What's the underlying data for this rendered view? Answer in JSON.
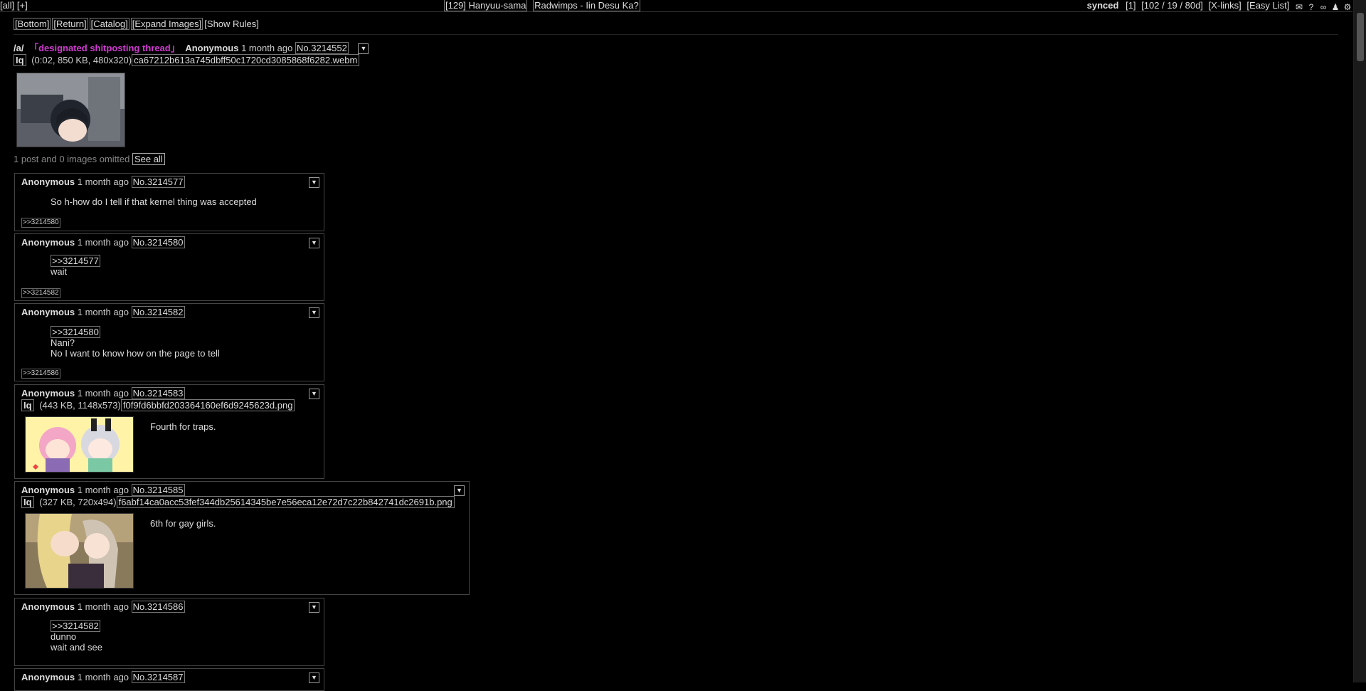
{
  "topbar": {
    "left": [
      "[all]",
      "[+]"
    ],
    "board_title": "[129] Hanyuu-sama",
    "song": "Radwimps - Iin Desu Ka?",
    "synced": "synced",
    "count1": "[1]",
    "stats": "[102 / 19 / 80d]",
    "xlinks": "[X-links]",
    "easylist": "[Easy List]",
    "icons": [
      "mail-icon",
      "help-icon",
      "infinity-icon",
      "user-icon",
      "gear-icon"
    ]
  },
  "nav": [
    "[Bottom]",
    "[Return]",
    "[Catalog]",
    "[Expand Images]",
    "[Show Rules]"
  ],
  "op": {
    "board": "/a/",
    "subject": "「designated shitposting thread」",
    "name": "Anonymous",
    "date": "1 month ago",
    "postno_label": "No.",
    "postno": "3214552",
    "iq": "Iq",
    "fileinfo": "(0:02, 850 KB, 480x320)",
    "filename": "ca67212b613a745dbff50c1720cd3085868f6282.webm"
  },
  "omitted": {
    "text": "1 post and 0 images omitted",
    "see_all": "See all"
  },
  "replies": [
    {
      "name": "Anonymous",
      "date": "1 month ago",
      "no": "No.3214577",
      "lines": [
        "So h-how do I tell if that kernel thing was accepted"
      ],
      "backlink": ">>3214580"
    },
    {
      "name": "Anonymous",
      "date": "1 month ago",
      "no": "No.3214580",
      "quote": ">>3214577",
      "lines": [
        "wait"
      ],
      "backlink": ">>3214582"
    },
    {
      "name": "Anonymous",
      "date": "1 month ago",
      "no": "No.3214582",
      "quote": ">>3214580",
      "lines": [
        "Nani?",
        "No I want to know how on the page to tell"
      ],
      "backlink": ">>3214586"
    },
    {
      "name": "Anonymous",
      "date": "1 month ago",
      "no": "No.3214583",
      "iq": "Iq",
      "fileinfo": "(443 KB, 1148x573)",
      "filename": "f0f9fd6bbfd203364160ef6d9245623d.png",
      "lines": [
        "Fourth for traps."
      ]
    },
    {
      "name": "Anonymous",
      "date": "1 month ago",
      "no": "No.3214585",
      "iq": "Iq",
      "fileinfo": "(327 KB, 720x494)",
      "filename": "f6abf14ca0acc53fef344db25614345be7e56eca12e72d7c22b842741dc2691b.png",
      "lines": [
        "6th for gay girls."
      ]
    },
    {
      "name": "Anonymous",
      "date": "1 month ago",
      "no": "No.3214586",
      "quote": ">>3214582",
      "lines": [
        "dunno",
        "wait and see"
      ]
    },
    {
      "name": "Anonymous",
      "date": "1 month ago",
      "no": "No.3214587"
    }
  ]
}
